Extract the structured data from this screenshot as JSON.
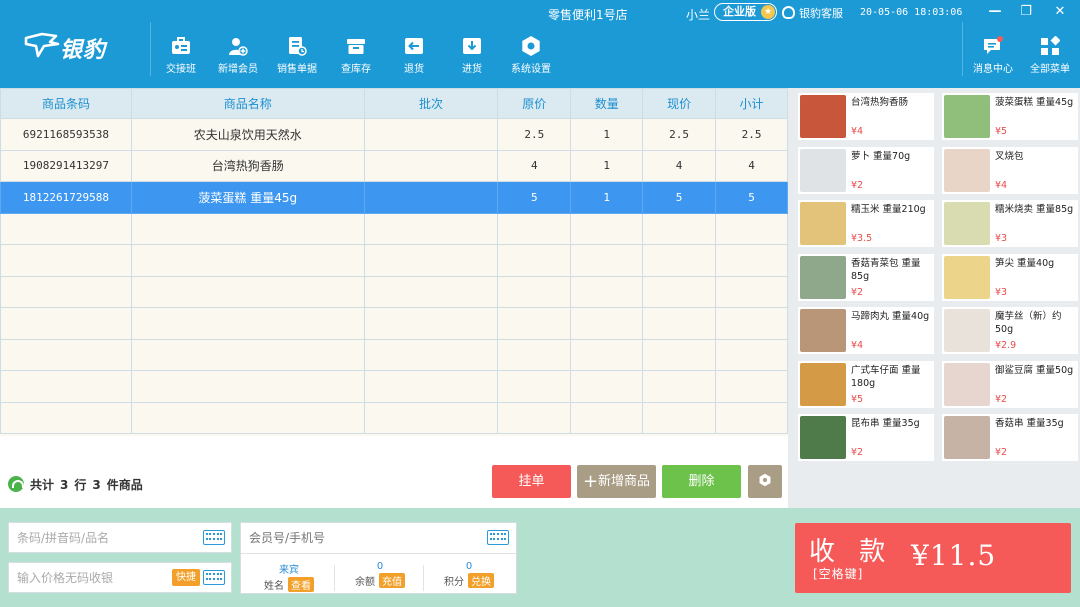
{
  "header": {
    "logo_text": "银豹",
    "store_name": "零售便利1号店",
    "user": "小兰",
    "edition": "企业版",
    "service": "银豹客服",
    "datetime": "20-05-06 18:03:06",
    "toolbar": [
      "交接班",
      "新增会员",
      "销售单据",
      "查库存",
      "退货",
      "进货",
      "系统设置"
    ],
    "right_tools": [
      "消息中心",
      "全部菜单"
    ]
  },
  "table": {
    "columns": [
      "商品条码",
      "商品名称",
      "批次",
      "原价",
      "数量",
      "现价",
      "小计"
    ],
    "rows": [
      [
        "6921168593538",
        "农夫山泉饮用天然水",
        "",
        "2.5",
        "1",
        "2.5",
        "2.5"
      ],
      [
        "1908291413297",
        "台湾热狗香肠",
        "",
        "4",
        "1",
        "4",
        "4"
      ],
      [
        "1812261729588",
        "菠菜蛋糕 重量45g",
        "",
        "5",
        "1",
        "5",
        "5"
      ]
    ],
    "selected_row": 2
  },
  "summary": {
    "prefix": "共计",
    "rows": "3",
    "rows_unit": "行",
    "items": "3",
    "items_unit": "件商品"
  },
  "actions": {
    "hold": "挂单",
    "add": "新增商品",
    "add_icon": "+",
    "delete": "删除"
  },
  "products": [
    {
      "name": "台湾热狗香肠",
      "price": "¥4",
      "thumb_color": "#c8563a"
    },
    {
      "name": "菠菜蛋糕 重量45g",
      "price": "¥5",
      "thumb_color": "#8fbf7a"
    },
    {
      "name": "萝卜 重量70g",
      "price": "¥2",
      "thumb_color": "#dfe3e6"
    },
    {
      "name": "叉烧包",
      "price": "¥4",
      "thumb_color": "#e9d5c8"
    },
    {
      "name": "糯玉米 重量210g",
      "price": "¥3.5",
      "thumb_color": "#e3c27a"
    },
    {
      "name": "糯米烧卖 重量85g",
      "price": "¥3",
      "thumb_color": "#d8dcb0"
    },
    {
      "name": "香菇青菜包 重量85g",
      "price": "¥2",
      "thumb_color": "#8fa78a"
    },
    {
      "name": "笋尖 重量40g",
      "price": "¥3",
      "thumb_color": "#ecd58a"
    },
    {
      "name": "马蹄肉丸 重量40g",
      "price": "¥4",
      "thumb_color": "#b99678"
    },
    {
      "name": "魔芋丝（新）约50g",
      "price": "¥2.9",
      "thumb_color": "#e8e2da"
    },
    {
      "name": "广式车仔面 重量180g",
      "price": "¥5",
      "thumb_color": "#d49a45"
    },
    {
      "name": "御鲨豆腐 重量50g",
      "price": "¥2",
      "thumb_color": "#e7d5cf"
    },
    {
      "name": "昆布串 重量35g",
      "price": "¥2",
      "thumb_color": "#4f7a4a"
    },
    {
      "name": "香菇串 重量35g",
      "price": "¥2",
      "thumb_color": "#c7b3a6"
    }
  ],
  "bottom": {
    "barcode_placeholder": "条码/拼音码/品名",
    "price_placeholder": "输入价格无码收银",
    "quick_label": "快捷",
    "member_placeholder": "会员号/手机号",
    "member": {
      "name_value": "来宾",
      "name_label": "姓名",
      "name_btn": "查看",
      "balance_value": "0",
      "balance_label": "余额",
      "balance_btn": "充值",
      "points_value": "0",
      "points_label": "积分",
      "points_btn": "兑换"
    },
    "checkout_label": "收 款",
    "checkout_hint": "[空格键]",
    "amount": "¥11.5"
  },
  "colors": {
    "brand": "#1c9ad6",
    "selected_row": "#3d97f0",
    "hold_button": "#f55a58",
    "add_button": "#a99d85",
    "delete_button": "#6cc24a",
    "checkout": "#f55a58",
    "bottom_bg": "#b3e0cf"
  },
  "icons": {
    "logo": "leopard-logo-icon",
    "toolbar": [
      "shift-handover-icon",
      "add-member-icon",
      "sales-receipt-icon",
      "inventory-box-icon",
      "return-icon",
      "purchase-icon",
      "settings-gear-icon"
    ],
    "right_tools": [
      "message-icon",
      "all-menu-icon"
    ],
    "service": "headset-icon",
    "keyboard": "keyboard-icon",
    "settings": "gear-icon"
  }
}
